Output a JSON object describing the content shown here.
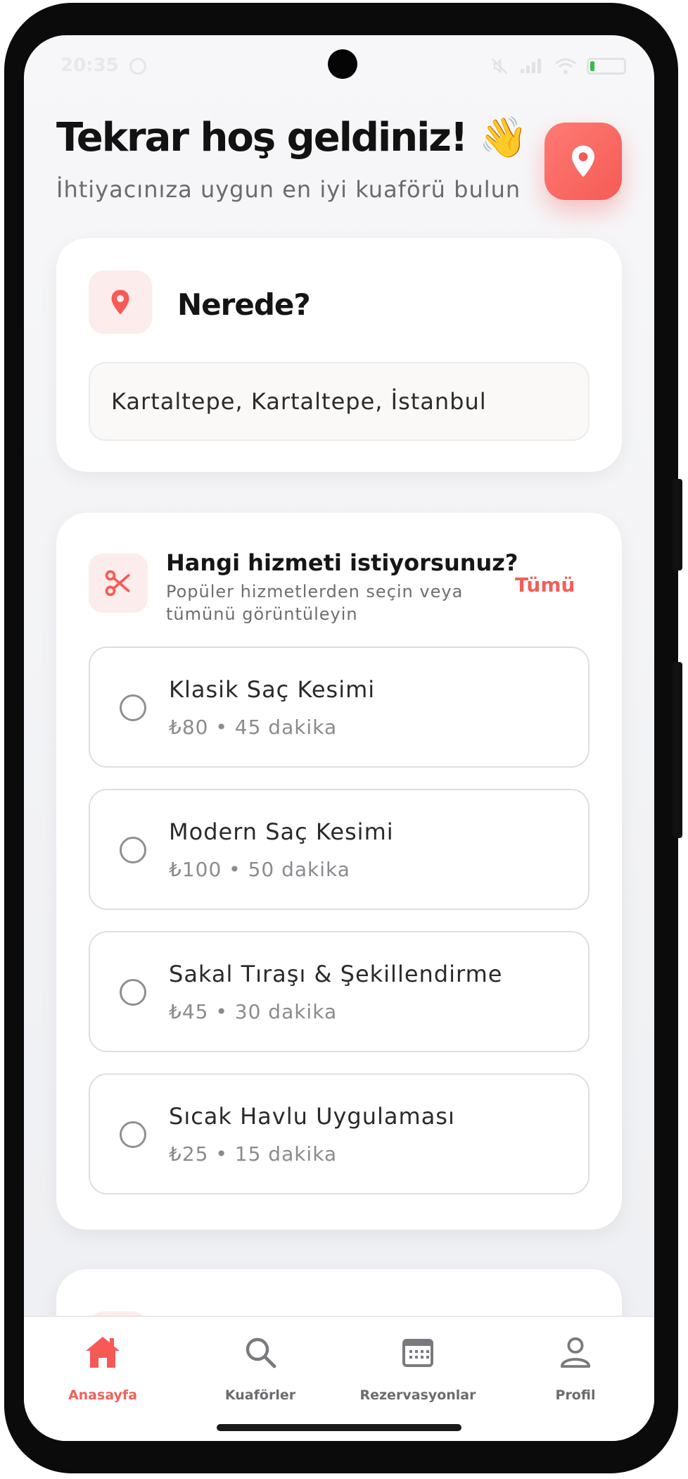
{
  "status_bar": {
    "time": "20:35"
  },
  "header": {
    "greeting": "Tekrar hoş geldiniz! 👋",
    "subtitle": "İhtiyacınıza uygun en iyi kuaförü bulun",
    "location_button_icon": "location-pin-icon"
  },
  "where_card": {
    "icon": "location-pin-icon",
    "title": "Nerede?",
    "location_value": "Kartaltepe, Kartaltepe, İstanbul"
  },
  "service_card": {
    "icon": "scissors-icon",
    "title": "Hangi hizmeti istiyorsunuz?",
    "description": "Popüler hizmetlerden seçin veya tümünü görüntüleyin",
    "all_link": "Tümü",
    "options": [
      {
        "name": "Klasik Saç Kesimi",
        "meta": "₺80 • 45 dakika",
        "selected": false
      },
      {
        "name": "Modern Saç Kesimi",
        "meta": "₺100 • 50 dakika",
        "selected": false
      },
      {
        "name": "Sakal Tıraşı & Şekillendirme",
        "meta": "₺45 • 30 dakika",
        "selected": false
      },
      {
        "name": "Sıcak Havlu Uygulaması",
        "meta": "₺25 • 15 dakika",
        "selected": false
      }
    ]
  },
  "tabbar": {
    "tabs": [
      {
        "label": "Anasayfa",
        "icon": "home-icon",
        "active": true
      },
      {
        "label": "Kuaförler",
        "icon": "search-icon",
        "active": false
      },
      {
        "label": "Rezervasyonlar",
        "icon": "calendar-icon",
        "active": false
      },
      {
        "label": "Profil",
        "icon": "user-icon",
        "active": false
      }
    ]
  },
  "colors": {
    "accent": "#f55a55",
    "accent_soft": "#fdecec"
  }
}
